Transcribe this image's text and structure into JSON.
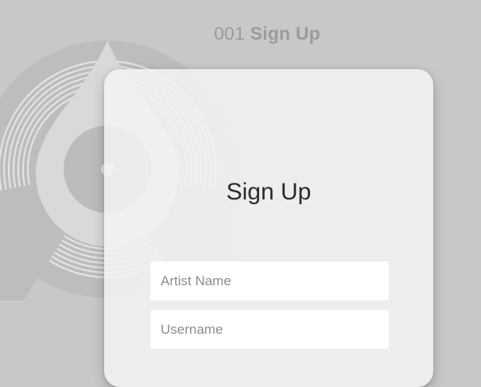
{
  "header": {
    "screen_number": "001",
    "screen_name": "Sign Up"
  },
  "logo": {
    "icon": "vinyl-drop-logo-icon"
  },
  "card": {
    "title": "Sign Up"
  },
  "form": {
    "artist_name": {
      "placeholder": "Artist Name",
      "value": ""
    },
    "username": {
      "placeholder": "Username",
      "value": ""
    }
  },
  "colors": {
    "background": "#c8c8c8",
    "card": "#f3f3f3",
    "title_text": "#9b9b9b",
    "heading_text": "#2b2b2b",
    "field_background": "#ffffff"
  }
}
